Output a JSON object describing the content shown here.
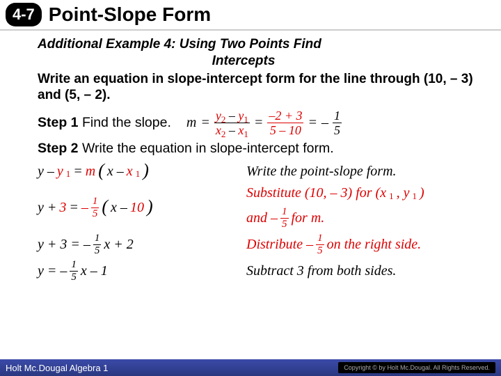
{
  "header": {
    "badge": "4-7",
    "title": "Point-Slope Form"
  },
  "example": {
    "title_l1": "Additional Example 4: Using Two Points Find",
    "title_l2": "Intercepts",
    "prompt": "Write an equation in slope-intercept form for the line through (10, – 3) and (5, – 2)."
  },
  "step1": {
    "label": "Step 1",
    "text": "Find the slope.",
    "m": "m",
    "eq": "=",
    "f1num": "y",
    "f1sub1": "2",
    "f1minus": " – ",
    "f1y": "y",
    "f1sub2": "1",
    "f1den_x": "x",
    "f1den_minus": " – ",
    "f2num": "–2 + 3",
    "f2den": "5 – 10",
    "f3num": "1",
    "f3den": "5",
    "neg": "–"
  },
  "step2": {
    "label": "Step 2",
    "text": "Write the equation in slope-intercept form."
  },
  "rows": {
    "r1": {
      "lhs_y": "y – ",
      "y1": "y",
      "y1sub": "1",
      "eq": " = ",
      "m": "m",
      "lp": "(",
      "x": "x – ",
      "x1": "x",
      "x1sub": "1",
      "rp": ")",
      "note": "Write the point-slope form."
    },
    "r2": {
      "lhs": "y + ",
      "three": "3",
      "eq": " = ",
      "neg": "–",
      "f_num": "1",
      "f_den": "5",
      "lp": "(",
      "x": "x – ",
      "ten": "10",
      "rp": ")",
      "note_a": "Substitute (10, – 3) for (x",
      "note_b": " , y",
      "note_c": " )",
      "note_d": "and –",
      "note_e": " for m.",
      "s1": "1",
      "s2": "1",
      "sf_n": "1",
      "sf_d": "5"
    },
    "r3": {
      "lhs": "y + 3 = –",
      "f_num": "1",
      "f_den": "5",
      "x": "x + 2",
      "note_a": "Distribute –",
      "note_b": " on the right side.",
      "sf_n": "1",
      "sf_d": "5"
    },
    "r4": {
      "lhs": "y = –",
      "f_num": "1",
      "f_den": "5",
      "x": "x – 1",
      "note": "Subtract 3 from both sides."
    }
  },
  "footer": {
    "left": "Holt Mc.Dougal Algebra 1",
    "right": "Copyright © by Holt Mc.Dougal. All Rights Reserved."
  }
}
